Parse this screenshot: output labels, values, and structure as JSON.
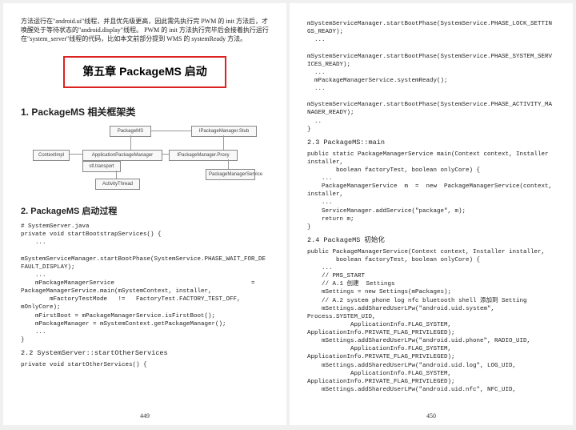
{
  "left": {
    "intro": "方法运行在\"android.ui\"线程，并且优先级更高，因此需先执行完 PWM 的 init 方法后，才唤醒处于等待状态的\"android.display\"线程。\nPWM 的 init 方法执行完毕后会接着执行运行在\"system_server\"线程的代码，比如本文前部分提到 WMS 的\nsystemReady 方法。",
    "chapter": "第五章  PackageMS 启动",
    "sec1_title": "1.  PackageMS 相关框架类",
    "diagram": {
      "b1": "PackageMS",
      "b2": "IPackageManager.Stub",
      "b3": "ContextImpl",
      "b4": "ApplicationPackageManager",
      "b5": "IPackageManager.Proxy",
      "b6": "PackageManagerService",
      "b7": "stl.transport",
      "b8": "ActivityThread"
    },
    "sec2_title": "2. PackageMS  启动过程",
    "code1": "# SystemServer.java\nprivate void startBootstrapServices() {\n    ...\n\nmSystemServiceManager.startBootPhase(SystemService.PHASE_WAIT_FOR_DEFAULT_DISPLAY);\n    ...\n    mPackageManagerService                                      =\nPackageManagerService.main(mSystemContext, installer,\n        mFactoryTestMode   !=   FactoryTest.FACTORY_TEST_OFF,\nmOnlyCore);\n    mFirstBoot = mPackageManagerService.isFirstBoot();\n    mPackageManager = mSystemContext.getPackageManager();\n    ...\n}",
    "sub22": "2.2 SystemServer::startOtherServices",
    "code2": "private void startOtherServices() {",
    "page_num": "449"
  },
  "right": {
    "code_top": "mSystemServiceManager.startBootPhase(SystemService.PHASE_LOCK_SETTINGS_READY);\n  ...\n\nmSystemServiceManager.startBootPhase(SystemService.PHASE_SYSTEM_SERVICES_READY);\n  ...\n  mPackageManagerService.systemReady();\n  ...\n\nmSystemServiceManager.startBootPhase(SystemService.PHASE_ACTIVITY_MANAGER_READY);\n  ..\n}",
    "sub23": "2.3 PackageMS::main",
    "code23": "public static PackageManagerService main(Context context, Installer installer,\n        boolean factoryTest, boolean onlyCore) {\n    ...\n    PackageManagerService  m  =  new  PackageManagerService(context, installer,\n    ...\n    ServiceManager.addService(\"package\", m);\n    return m;\n}",
    "sub24": "2.4 PackageMS 初始化",
    "code24": "public PackageManagerService(Context context, Installer installer,\n        boolean factoryTest, boolean onlyCore) {\n    ...\n    // PMS_START\n    // A.1 创建  Settings\n    mSettings = new Settings(mPackages);\n    // A.2 system phone log nfc bluetooth shell 添加到 Setting\n    mSettings.addSharedUserLPw(\"android.uid.system\",\nProcess.SYSTEM_UID,\n            ApplicationInfo.FLAG_SYSTEM,\nApplicationInfo.PRIVATE_FLAG_PRIVILEGED);\n    mSettings.addSharedUserLPw(\"android.uid.phone\", RADIO_UID,\n            ApplicationInfo.FLAG_SYSTEM,\nApplicationInfo.PRIVATE_FLAG_PRIVILEGED);\n    mSettings.addSharedUserLPw(\"android.uid.log\", LOG_UID,\n            ApplicationInfo.FLAG_SYSTEM,\nApplicationInfo.PRIVATE_FLAG_PRIVILEGED);\n    mSettings.addSharedUserLPw(\"android.uid.nfc\", NFC_UID,",
    "page_num": "450"
  }
}
